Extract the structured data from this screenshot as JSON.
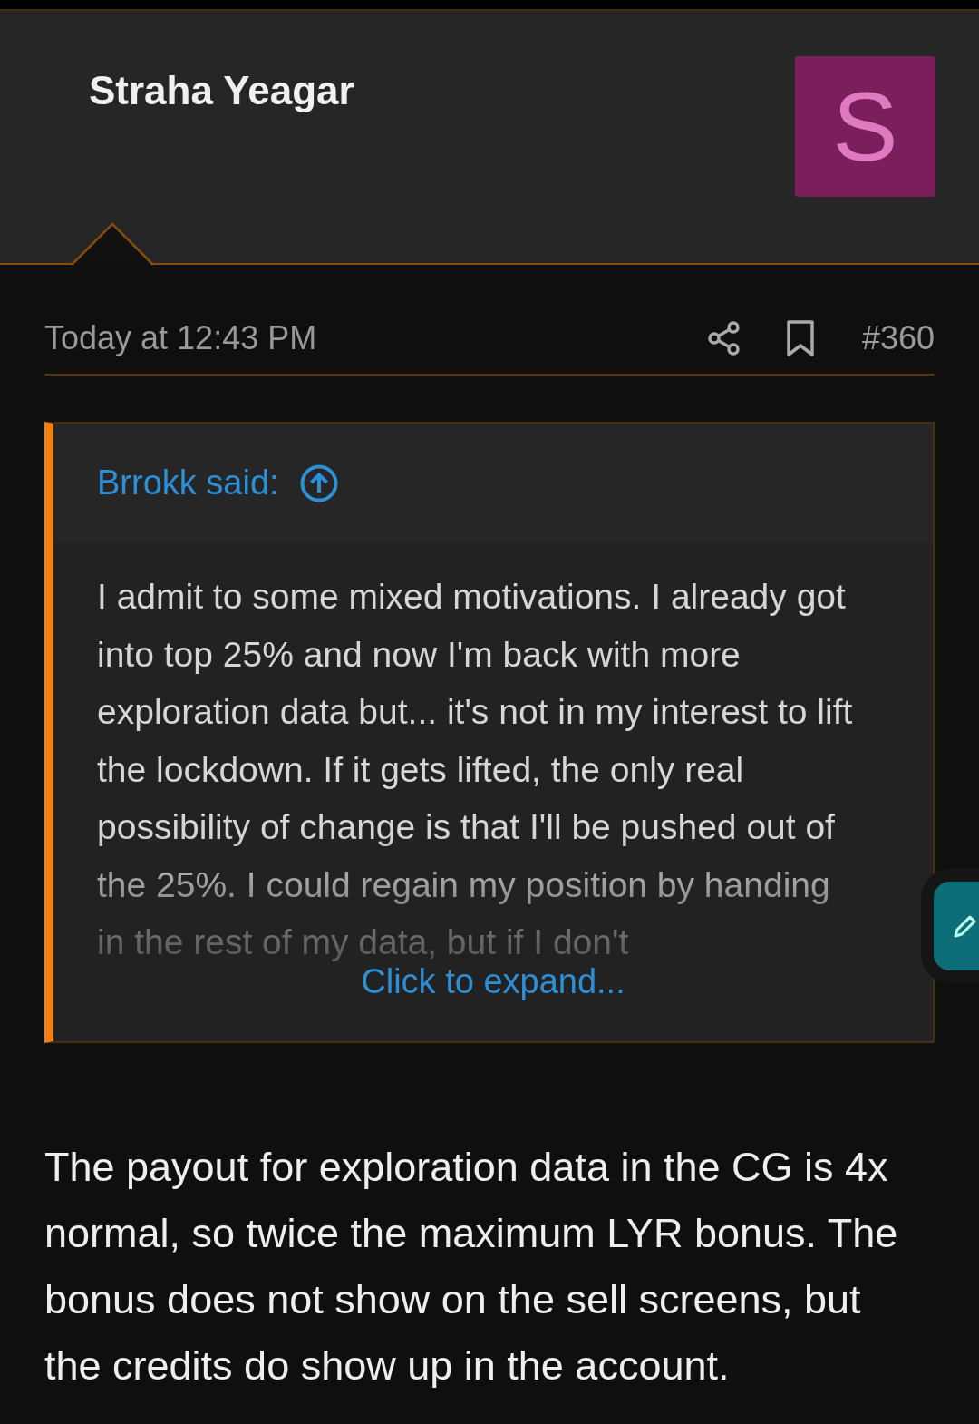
{
  "author": {
    "name": "Straha Yeagar",
    "avatar_letter": "S"
  },
  "meta": {
    "time": "Today at 12:43 PM",
    "post_number": "#360"
  },
  "quote": {
    "author": "Brrokk said:",
    "text": "I admit to some mixed motivations. I already got into top 25% and now I'm back with more exploration data but... it's not in my interest to lift the lockdown. If it gets lifted, the only real possibility of change is that I'll be pushed out of the 25%. I could regain my position by handing in the rest of my data, but if I don't",
    "expand_label": "Click to expand..."
  },
  "body": "The payout for exploration data in the CG is 4x normal, so twice the maximum LYR bonus. The bonus does not show on the sell screens, but the credits do show up in the account."
}
